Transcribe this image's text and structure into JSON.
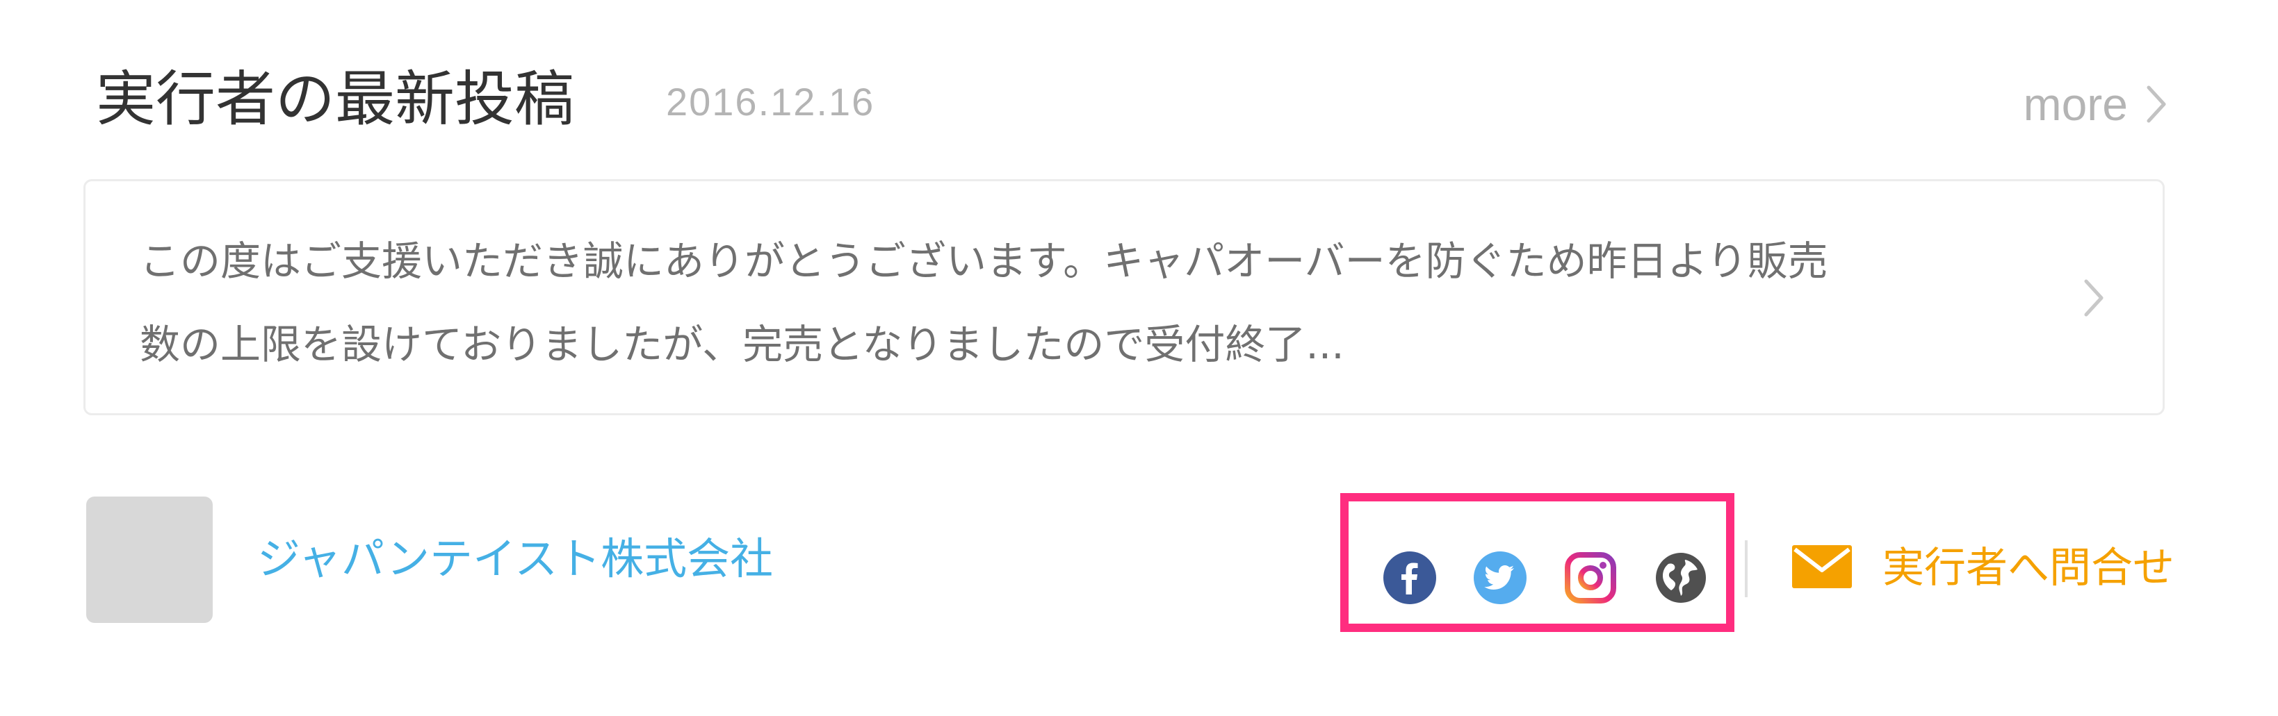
{
  "section": {
    "title": "実行者の最新投稿",
    "date": "2016.12.16",
    "more_label": "more"
  },
  "post": {
    "line1": "この度はご支援いただき誠にありがとうございます。キャパオーバーを防ぐため昨日より販売",
    "line2": "数の上限を設けておりましたが、完売となりましたので受付終了..."
  },
  "owner": {
    "name": "ジャパンテイスト株式会社"
  },
  "social": {
    "icons": [
      "facebook-icon",
      "twitter-icon",
      "instagram-icon",
      "website-globe-icon"
    ]
  },
  "contact": {
    "label": "実行者へ問合せ"
  },
  "colors": {
    "title": "#333333",
    "muted": "#b4b4b4",
    "body_text": "#707070",
    "link_blue": "#45b0e5",
    "accent_orange": "#f5a100",
    "highlight_pink": "#ff2d7f",
    "facebook": "#3b5998",
    "twitter": "#55acee",
    "globe": "#505050"
  }
}
